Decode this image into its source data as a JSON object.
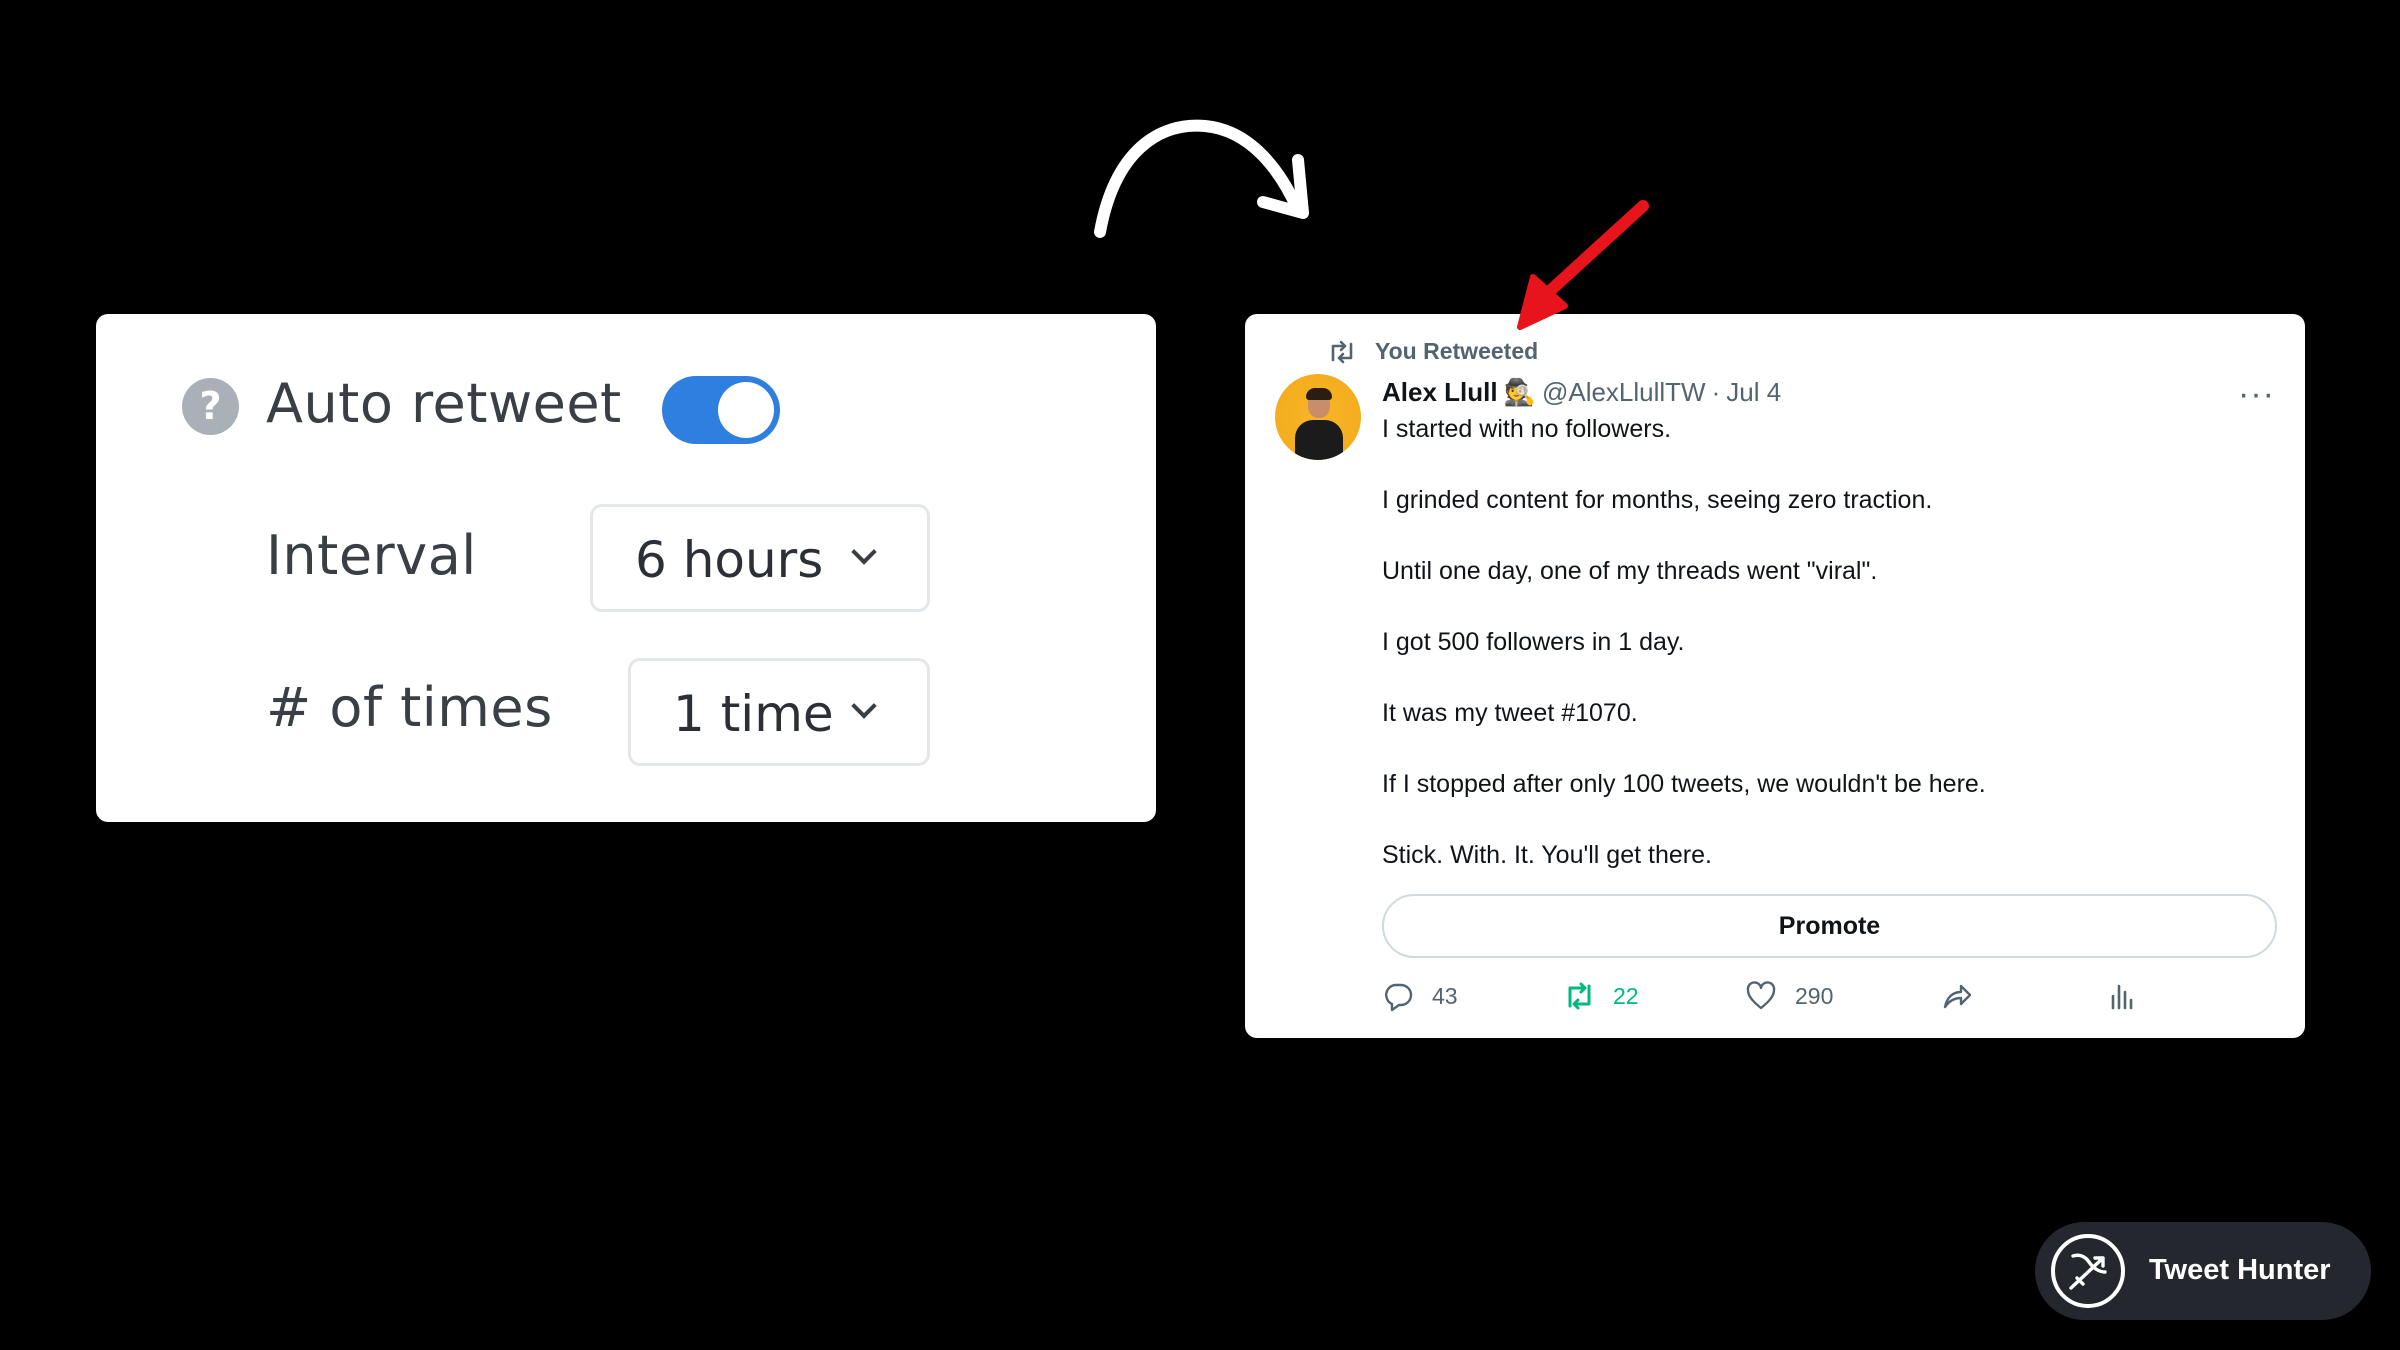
{
  "settings": {
    "auto_retweet_label": "Auto retweet",
    "auto_retweet_enabled": true,
    "help_symbol": "?",
    "interval_label": "Interval",
    "interval_value": "6 hours",
    "times_label": "# of times",
    "times_value": "1 time",
    "toggle_color": "#2f7fe0"
  },
  "tweet": {
    "retweet_context": "You Retweeted",
    "author_name": "Alex Llull",
    "author_emoji": "🕵️",
    "handle": "@AlexLlullTW",
    "separator": "·",
    "date": "Jul 4",
    "lines": [
      "I started with no followers.",
      "I grinded content for months, seeing zero traction.",
      "Until one day, one of my threads went \"viral\".",
      "I got 500 followers in 1 day.",
      "It was my tweet #1070.",
      "If I stopped after only 100 tweets, we wouldn't be here.",
      "Stick. With. It. You'll get there."
    ],
    "promote_label": "Promote",
    "replies": "43",
    "retweets": "22",
    "likes": "290",
    "retweet_active_color": "#00ba7c"
  },
  "brand": {
    "name": "Tweet Hunter"
  },
  "colors": {
    "background": "#000000",
    "pointer_arrow": "#e8141b",
    "curved_arrow": "#ffffff"
  }
}
